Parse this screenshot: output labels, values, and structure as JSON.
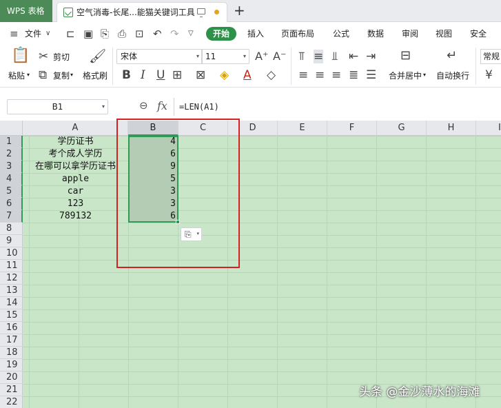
{
  "app_tab": "WPS 表格",
  "document_tab": {
    "title": "空气消毒-长尾...能猫关键词工具"
  },
  "menu": {
    "file": "文件",
    "tabs": [
      "开始",
      "插入",
      "页面布局",
      "公式",
      "数据",
      "审阅",
      "视图",
      "安全"
    ]
  },
  "ribbon": {
    "paste": "粘贴",
    "cut": "剪切",
    "copy": "复制",
    "format_painter": "格式刷",
    "font_name": "宋体",
    "font_size": "11",
    "merge_center": "合并居中",
    "wrap_text": "自动换行",
    "number_format": "常规",
    "currency_symbol": "¥"
  },
  "formula_bar": {
    "name_box": "B1",
    "fx": "fx",
    "formula": "=LEN(A1)"
  },
  "sheet": {
    "columns": [
      "A",
      "B",
      "C",
      "D",
      "E",
      "F",
      "G",
      "H",
      "I"
    ],
    "rows": [
      "1",
      "2",
      "3",
      "4",
      "5",
      "6",
      "7",
      "8",
      "9",
      "10",
      "11",
      "12",
      "13",
      "14",
      "15",
      "16",
      "17",
      "18",
      "19",
      "20",
      "21",
      "22"
    ],
    "column_a": [
      "学历证书",
      "考个成人学历",
      "在哪可以拿学历证书",
      "apple",
      "car",
      "123",
      "789132"
    ],
    "column_b": [
      "4",
      "6",
      "9",
      "5",
      "3",
      "3",
      "6"
    ],
    "selection": "B1:B7"
  },
  "watermark": "头条 @金沙薄水的海滩",
  "colors": {
    "accent": "#2d9149",
    "sheet_background": "#c9e6c9",
    "highlight_box": "#d4201f",
    "app_tab": "#4c8a57"
  }
}
